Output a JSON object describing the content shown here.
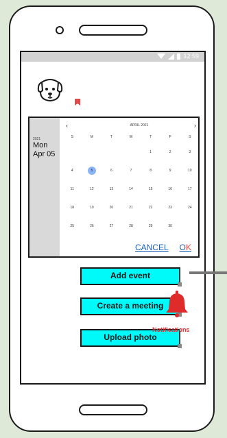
{
  "status_bar": {
    "time": "12:59"
  },
  "date_picker": {
    "year": "2021",
    "weekday": "Mon",
    "date": "Apr 05",
    "month_label": "APRIL 2021",
    "prev_icon": "‹",
    "next_icon": "›",
    "weekday_headers": [
      "S",
      "M",
      "T",
      "W",
      "T",
      "F",
      "S"
    ],
    "weeks": [
      [
        "",
        "",
        "",
        "",
        "1",
        "2",
        "3"
      ],
      [
        "4",
        "5",
        "6",
        "7",
        "8",
        "9",
        "10"
      ],
      [
        "11",
        "12",
        "13",
        "14",
        "15",
        "16",
        "17"
      ],
      [
        "18",
        "19",
        "20",
        "21",
        "22",
        "23",
        "24"
      ],
      [
        "25",
        "26",
        "27",
        "28",
        "29",
        "30",
        ""
      ]
    ],
    "selected_day": "5",
    "cancel_label": "CANCEL",
    "ok_label_o": "O",
    "ok_label_k": "K"
  },
  "buttons": {
    "add_event": "Add event",
    "create_meeting": "Create a meeting",
    "upload_photo": "Upload photo"
  },
  "notifications": {
    "label": "Notifications"
  },
  "colors": {
    "accent_button": "#00fafa",
    "selected_day": "#8ab4f8",
    "link_blue": "#1e5fb8",
    "alert_red": "#e03030"
  },
  "icons": [
    "dog-avatar-icon",
    "bookmark-icon",
    "bell-icon",
    "wifi-icon",
    "signal-icon",
    "battery-icon"
  ]
}
